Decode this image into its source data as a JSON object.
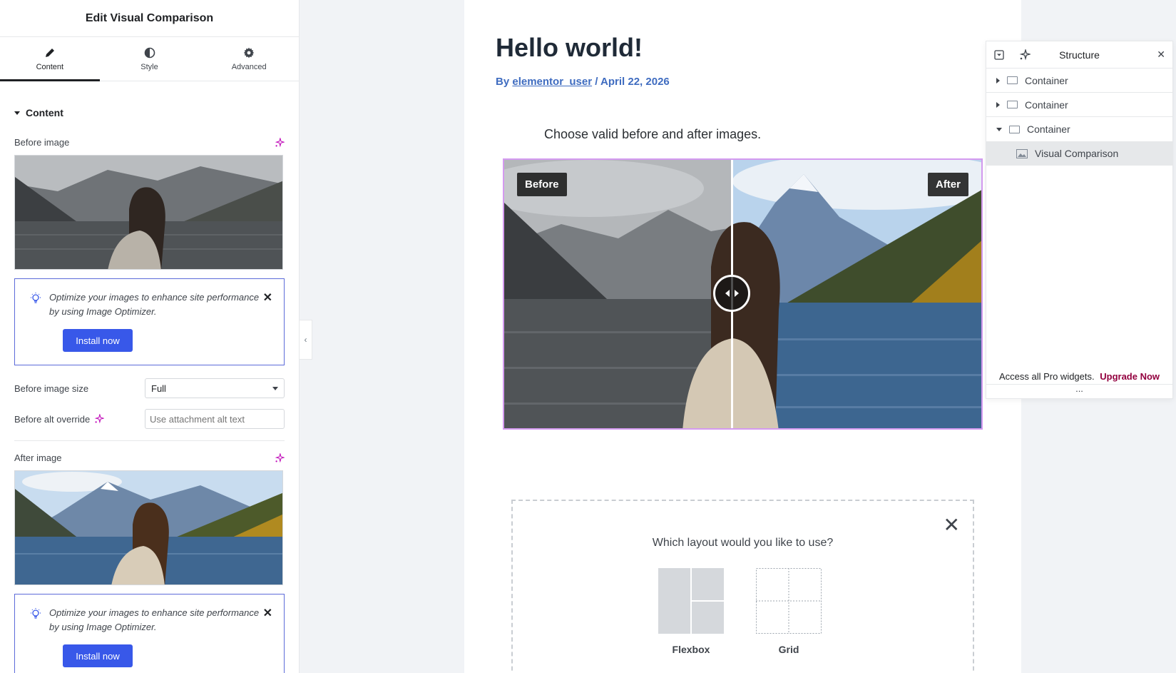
{
  "panel": {
    "title": "Edit Visual Comparison",
    "tabs": [
      {
        "label": "Content",
        "icon": "pencil-icon"
      },
      {
        "label": "Style",
        "icon": "half-circle-icon"
      },
      {
        "label": "Advanced",
        "icon": "gear-icon"
      }
    ],
    "active_tab": "Content",
    "section_title": "Content",
    "before_image_label": "Before image",
    "after_image_label": "After image",
    "notice_text": "Optimize your images to enhance site performance by using Image Optimizer.",
    "install_label": "Install now",
    "before_size_label": "Before image size",
    "before_size_value": "Full",
    "before_alt_label": "Before alt override",
    "before_alt_placeholder": "Use attachment alt text"
  },
  "canvas": {
    "post_title": "Hello world!",
    "meta_by": "By",
    "meta_author": "elementor_user",
    "meta_date": "/ April 22, 2026",
    "choose_message": "Choose valid before and after images.",
    "before_label": "Before",
    "after_label": "After",
    "layout_question": "Which layout would you like to use?",
    "layout_options": [
      {
        "name": "Flexbox"
      },
      {
        "name": "Grid"
      }
    ]
  },
  "structure": {
    "title": "Structure",
    "items": [
      {
        "label": "Container",
        "expanded": false
      },
      {
        "label": "Container",
        "expanded": false
      },
      {
        "label": "Container",
        "expanded": true
      }
    ],
    "selected_item": "Visual Comparison",
    "pro_text": "Access all Pro widgets.",
    "upgrade_label": "Upgrade Now",
    "footer": "..."
  },
  "colors": {
    "accent_blue": "#3858e9",
    "ai_magenta": "#c00bb9",
    "selection_border": "#d49af0",
    "upgrade": "#93003f",
    "meta_link": "#3f6cc0"
  }
}
